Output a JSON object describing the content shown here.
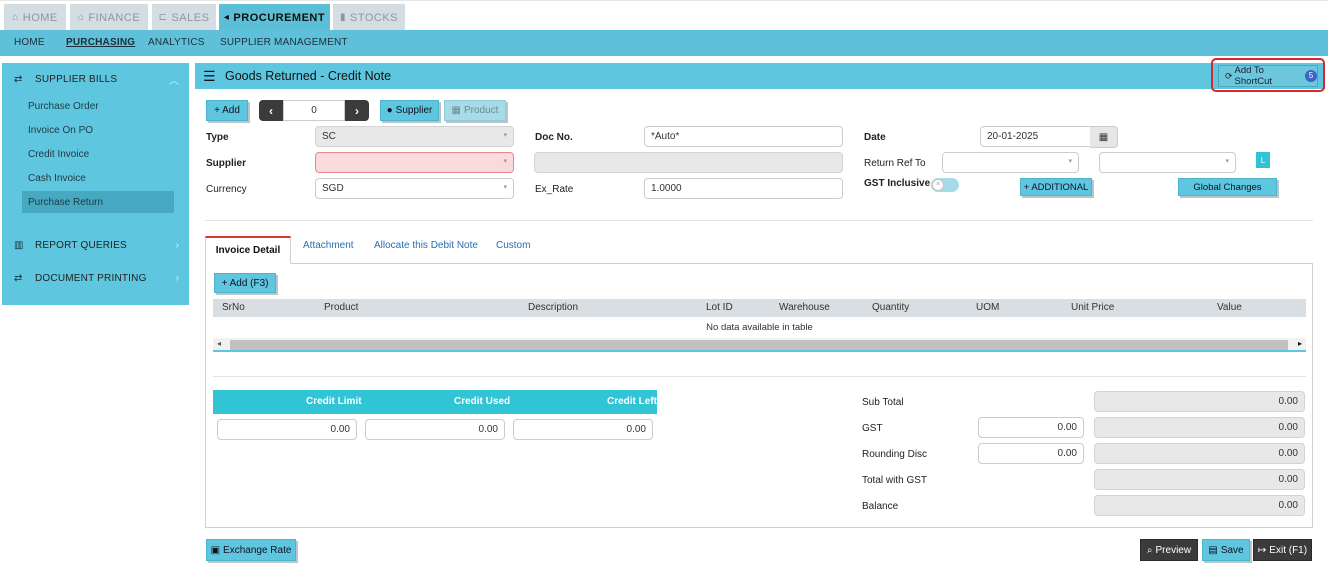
{
  "modules": [
    {
      "label": "HOME",
      "icon": "⌂"
    },
    {
      "label": "FINANCE",
      "icon": "🏛"
    },
    {
      "label": "SALES",
      "icon": "🛒"
    },
    {
      "label": "PROCUREMENT",
      "icon": "📣"
    },
    {
      "label": "STOCKS",
      "icon": "▮"
    }
  ],
  "subnav": [
    "HOME",
    "PURCHASING",
    "ANALYTICS",
    "SUPPLIER MANAGEMENT"
  ],
  "sidebar": {
    "supplier_bills": "SUPPLIER BILLS",
    "items": [
      "Purchase Order",
      "Invoice On PO",
      "Credit Invoice",
      "Cash Invoice",
      "Purchase Return"
    ],
    "report_queries": "REPORT QUERIES",
    "document_printing": "DOCUMENT PRINTING"
  },
  "panel": {
    "title": "Goods Returned - Credit Note",
    "shortcut_label": "Add To ShortCut",
    "shortcut_badge": "5"
  },
  "toolbar": {
    "add": "+ Add",
    "record_no": "0",
    "supplier": "Supplier",
    "product": "Product"
  },
  "form": {
    "type_label": "Type",
    "type_value": "SC",
    "supplier_label": "Supplier",
    "supplier_value": "",
    "currency_label": "Currency",
    "currency_value": "SGD",
    "docno_label": "Doc No.",
    "docno_value": "*Auto*",
    "exrate_label": "Ex_Rate",
    "exrate_value": "1.0000",
    "date_label": "Date",
    "date_value": "20-01-2025",
    "returnref_label": "Return Ref To",
    "gst_inclusive_label": "GST Inclusive",
    "additional": "+ ADDITIONAL",
    "global_changes": "Global Changes",
    "l_button": "L"
  },
  "tabs": [
    "Invoice Detail",
    "Attachment",
    "Allocate this Debit Note",
    "Custom"
  ],
  "detail": {
    "add_f3": "+ Add (F3)",
    "columns": [
      "SrNo",
      "Product",
      "Description",
      "Lot ID",
      "Warehouse",
      "Quantity",
      "UOM",
      "Unit Price",
      "Value"
    ],
    "empty_message": "No data available in table"
  },
  "credit": {
    "headers": [
      "Credit Limit",
      "Credit Used",
      "Credit Left"
    ],
    "values": [
      "0.00",
      "0.00",
      "0.00"
    ]
  },
  "totals": {
    "sub_total_label": "Sub Total",
    "sub_total": "0.00",
    "gst_label": "GST",
    "gst_input": "0.00",
    "gst": "0.00",
    "rounding_label": "Rounding Disc",
    "rounding_input": "0.00",
    "rounding": "0.00",
    "total_gst_label": "Total with GST",
    "total_gst": "0.00",
    "balance_label": "Balance",
    "balance": "0.00"
  },
  "footer": {
    "exchange_rate": "Exchange Rate",
    "preview": "Preview",
    "save": "Save",
    "exit": "Exit (F1)"
  }
}
